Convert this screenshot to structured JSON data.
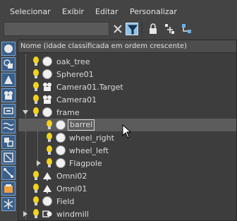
{
  "menu": {
    "items": [
      "Selecionar",
      "Exibir",
      "Editar",
      "Personalizar"
    ]
  },
  "toolbar": {
    "search_value": "",
    "search_placeholder": ""
  },
  "tree": {
    "header": "Nome (idade classificada em ordem crescente)",
    "rows": [
      {
        "name": "oak_tree",
        "icon": "sphere-icon",
        "selected": false
      },
      {
        "name": "Sphere01",
        "icon": "sphere-icon",
        "selected": false
      },
      {
        "name": "Camera01.Target",
        "icon": "camera-icon",
        "selected": false
      },
      {
        "name": "Camera01",
        "icon": "camera-icon",
        "selected": false
      },
      {
        "name": "frame",
        "icon": "sphere-icon",
        "expanded": true
      },
      {
        "name": "barrel",
        "icon": "sphere-icon",
        "selected": true
      },
      {
        "name": "wheel_right",
        "icon": "sphere-icon",
        "selected": false
      },
      {
        "name": "wheel_left",
        "icon": "sphere-icon",
        "selected": false
      },
      {
        "name": "Flagpole",
        "icon": "sphere-icon",
        "expanded": false
      },
      {
        "name": "Omni02",
        "icon": "omni-light-icon",
        "selected": false
      },
      {
        "name": "Omni01",
        "icon": "omni-light-icon",
        "selected": false
      },
      {
        "name": "Field",
        "icon": "sphere-icon",
        "selected": false
      },
      {
        "name": "windmill",
        "icon": "group-icon",
        "expanded": false
      }
    ]
  },
  "colors": {
    "panel": "#444444",
    "tree_bg": "#3d3d3d",
    "selected_row": "#5c5c5c",
    "bulb": "#f2d21b",
    "side_button": "#3a5f8a",
    "active_filter": "#8ec1e6"
  }
}
